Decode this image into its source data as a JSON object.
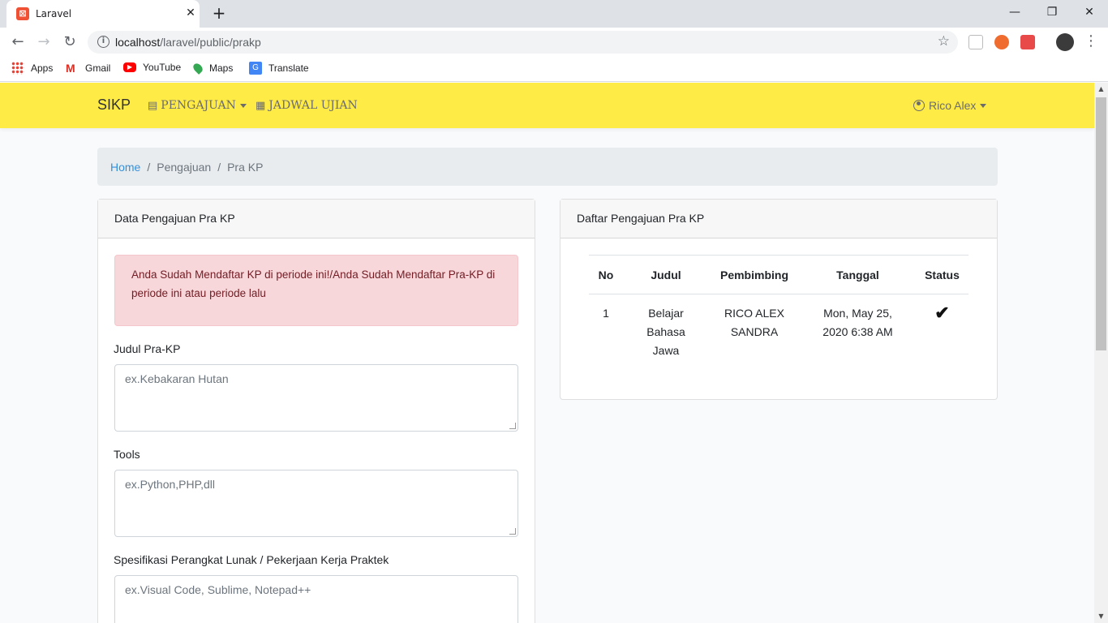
{
  "browser": {
    "tab_title": "Laravel",
    "url_host": "localhost",
    "url_path": "/laravel/public/prakp",
    "bookmarks": [
      "Apps",
      "Gmail",
      "YouTube",
      "Maps",
      "Translate"
    ]
  },
  "navbar": {
    "brand": "SIKP",
    "menu": [
      {
        "label": "PENGAJUAN",
        "icon": "id-card-icon",
        "dropdown": true
      },
      {
        "label": "JADWAL UJIAN",
        "icon": "calendar-icon",
        "dropdown": false
      }
    ],
    "user": "Rico Alex"
  },
  "breadcrumb": {
    "home": "Home",
    "level2": "Pengajuan",
    "current": "Pra KP"
  },
  "form_card": {
    "title": "Data Pengajuan Pra KP",
    "alert": "Anda Sudah Mendaftar KP di periode ini!/Anda Sudah Mendaftar Pra-KP di periode ini atau periode lalu",
    "fields": [
      {
        "label": "Judul Pra-KP",
        "placeholder": "ex.Kebakaran Hutan"
      },
      {
        "label": "Tools",
        "placeholder": "ex.Python,PHP,dll"
      },
      {
        "label": "Spesifikasi Perangkat Lunak / Pekerjaan Kerja Praktek",
        "placeholder": "ex.Visual Code, Sublime, Notepad++"
      }
    ]
  },
  "list_card": {
    "title": "Daftar Pengajuan Pra KP",
    "columns": [
      "No",
      "Judul",
      "Pembimbing",
      "Tanggal",
      "Status"
    ],
    "rows": [
      {
        "no": "1",
        "judul": "Belajar Bahasa Jawa",
        "pembimbing": "RICO ALEX SANDRA",
        "tanggal": "Mon, May 25, 2020 6:38 AM",
        "status": "approved"
      }
    ]
  },
  "colors": {
    "navbar": "#ffeb46",
    "link": "#3490dc",
    "alert_bg": "#f8d7da",
    "alert_text": "#721c24"
  }
}
